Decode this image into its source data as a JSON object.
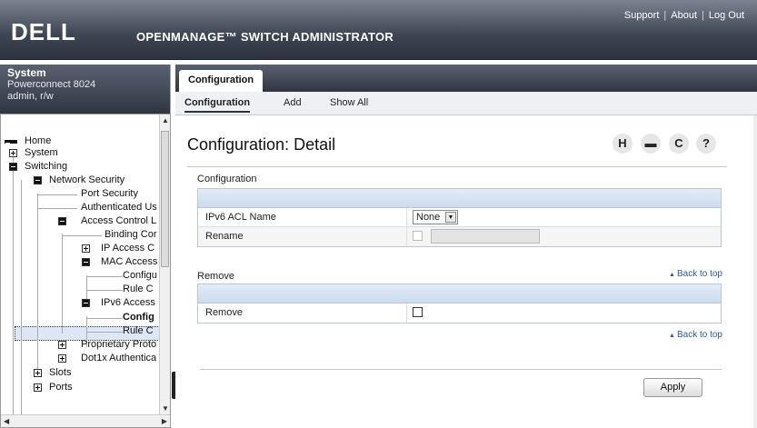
{
  "header": {
    "logo": "DELL",
    "app_title": "OPENMANAGE™ SWITCH ADMINISTRATOR",
    "links": [
      "Support",
      "About",
      "Log Out"
    ]
  },
  "system": {
    "title": "System",
    "model": "Powerconnect 8024",
    "user": "admin, r/w"
  },
  "tree": {
    "items": [
      "Home",
      "System",
      "Switching",
      "Network Security",
      "Port Security",
      "Authenticated Us",
      "Access Control L",
      "Binding Cor",
      "IP Access C",
      "MAC Access",
      "Configu",
      "Rule C",
      "IPv6 Access",
      "Config",
      "Rule C",
      "Proprietary Proto",
      "Dot1x Authentica",
      "Slots",
      "Ports"
    ]
  },
  "tabs": {
    "main": "Configuration",
    "sub": [
      "Configuration",
      "Add",
      "Show All"
    ]
  },
  "page": {
    "title": "Configuration: Detail",
    "icons": [
      "save-icon",
      "print-icon",
      "refresh-icon",
      "help-icon"
    ],
    "icon_glyphs": [
      "H",
      "▬",
      "C",
      "?"
    ],
    "config_section": "Configuration",
    "ipv6_acl_name_label": "IPv6 ACL Name",
    "ipv6_acl_name_value": "None",
    "rename_label": "Rename",
    "remove_section": "Remove",
    "back_to_top": "Back to top",
    "remove_label": "Remove",
    "apply_label": "Apply"
  },
  "colors": {
    "header_dark": "#2d3340",
    "table_header": "#cbdbee",
    "link": "#2b5aa8",
    "selected_row": "#dde7f5"
  }
}
